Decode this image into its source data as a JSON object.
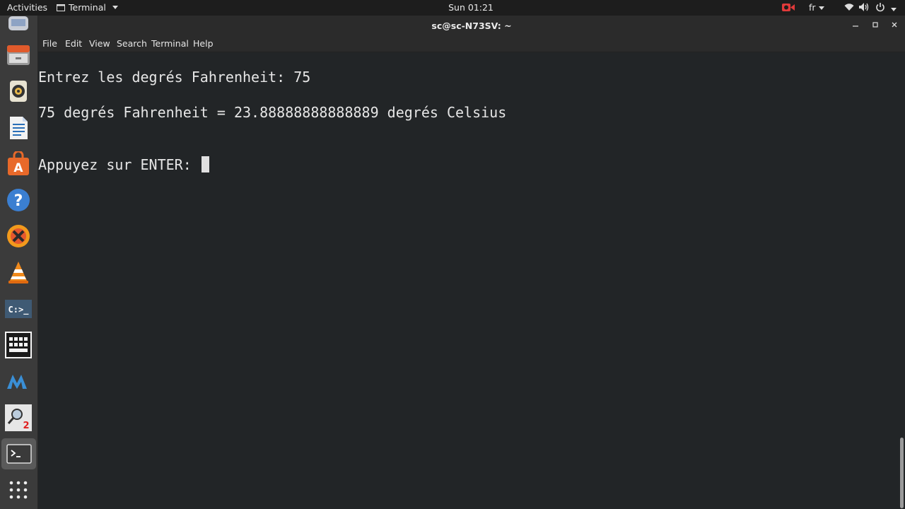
{
  "topbar": {
    "activities": "Activities",
    "app_menu": "Terminal",
    "clock": "Sun 01:21",
    "keyboard_layout": "fr"
  },
  "window": {
    "title": "sc@sc-N73SV: ~",
    "menus": [
      "File",
      "Edit",
      "View",
      "Search",
      "Terminal",
      "Help"
    ]
  },
  "terminal": {
    "lines": [
      "Entrez les degrés Fahrenheit: 75",
      "75 degrés Fahrenheit = 23.88888888888889 degrés Celsius",
      "Appuyez sur ENTER: "
    ]
  },
  "dock": {
    "items": [
      {
        "name": "app-icon"
      },
      {
        "name": "files-icon"
      },
      {
        "name": "rhythmbox-icon"
      },
      {
        "name": "writer-icon"
      },
      {
        "name": "software-icon"
      },
      {
        "name": "help-icon"
      },
      {
        "name": "crossover-icon"
      },
      {
        "name": "vlc-icon"
      },
      {
        "name": "dosbox-icon"
      },
      {
        "name": "keyboard-icon"
      },
      {
        "name": "mame-icon"
      },
      {
        "name": "search-tool-icon"
      },
      {
        "name": "terminal-icon"
      },
      {
        "name": "show-apps-icon"
      }
    ]
  },
  "colors": {
    "terminal_bg": "#222527",
    "terminal_fg": "#e6e6e6",
    "dock_bg": "#3b3b3b",
    "topbar_bg": "#1d1d1d"
  }
}
